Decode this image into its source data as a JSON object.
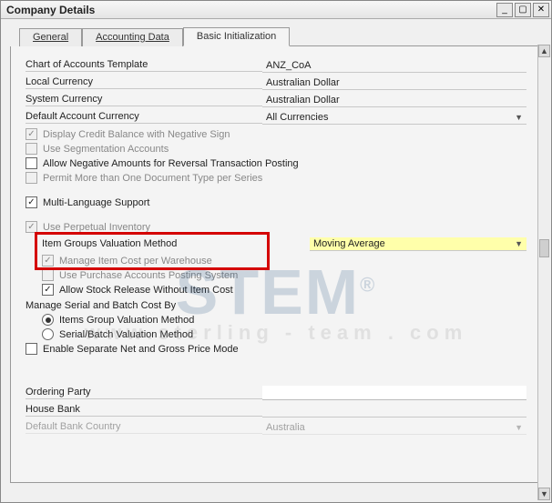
{
  "window": {
    "title": "Company Details"
  },
  "tabs": {
    "items": [
      {
        "label": "General"
      },
      {
        "label": "Accounting Data"
      },
      {
        "label": "Basic Initialization"
      }
    ],
    "active_index": 2
  },
  "fields": {
    "chart_template": {
      "label": "Chart of Accounts Template",
      "value": "ANZ_CoA"
    },
    "local_currency": {
      "label": "Local Currency",
      "value": "Australian Dollar"
    },
    "system_currency": {
      "label": "System Currency",
      "value": "Australian Dollar"
    },
    "default_account_currency": {
      "label": "Default Account Currency",
      "value": "All Currencies"
    }
  },
  "checks": {
    "display_credit_neg": {
      "label": "Display Credit Balance with Negative Sign",
      "checked": true,
      "enabled": false
    },
    "use_segmentation": {
      "label": "Use Segmentation Accounts",
      "checked": false,
      "enabled": false
    },
    "allow_negative_reversal": {
      "label": "Allow Negative Amounts for Reversal Transaction Posting",
      "checked": false,
      "enabled": true
    },
    "permit_multi_doctype": {
      "label": "Permit More than One Document Type per Series",
      "checked": false,
      "enabled": false
    },
    "multi_language": {
      "label": "Multi-Language Support",
      "checked": true,
      "enabled": true
    },
    "use_perpetual_inventory": {
      "label": "Use Perpetual Inventory",
      "checked": true,
      "enabled": false
    },
    "item_groups_valuation": {
      "label": "Item Groups Valuation Method",
      "value": "Moving Average"
    },
    "manage_item_cost_wh": {
      "label": "Manage Item Cost per Warehouse",
      "checked": true,
      "enabled": false
    },
    "use_purchase_accounts": {
      "label": "Use Purchase Accounts Posting System",
      "checked": false,
      "enabled": false
    },
    "allow_stock_release_wo_cost": {
      "label": "Allow Stock Release Without Item Cost",
      "checked": true,
      "enabled": true
    },
    "manage_serial_batch_heading": "Manage Serial and Batch Cost By",
    "radio_items_group_valuation": {
      "label": "Items Group Valuation Method",
      "selected": true
    },
    "radio_serial_batch_valuation": {
      "label": "Serial/Batch Valuation Method",
      "selected": false
    },
    "enable_separate_price_mode": {
      "label": "Enable Separate Net and Gross Price Mode",
      "checked": false,
      "enabled": true
    }
  },
  "bottom": {
    "ordering_party": {
      "label": "Ordering Party",
      "value": ""
    },
    "house_bank": {
      "label": "House Bank",
      "value": ""
    },
    "default_bank_country": {
      "label": "Default Bank Country",
      "value": "Australia"
    }
  },
  "chart_data": null
}
